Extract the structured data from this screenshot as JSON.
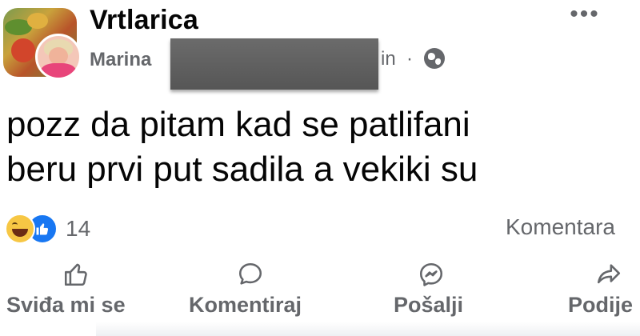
{
  "post": {
    "group_name": "Vrtlarica",
    "author_name": "Marina",
    "time_fragment": "in",
    "separator": "·",
    "visibility_icon": "globe-icon",
    "more_label": "•••",
    "text_lines": [
      "pozz da pitam kad se patlifani",
      "beru prvi put sadila a vekiki su"
    ]
  },
  "stats": {
    "reaction_icons": [
      "haha-icon",
      "like-icon"
    ],
    "reaction_count": "14",
    "comments_label": "Komentara"
  },
  "actions": [
    {
      "icon": "thumbs-up-icon",
      "label": "Sviđa mi se"
    },
    {
      "icon": "comment-icon",
      "label": "Komentiraj"
    },
    {
      "icon": "messenger-icon",
      "label": "Pošalji"
    },
    {
      "icon": "share-icon",
      "label": "Podije"
    }
  ],
  "colors": {
    "text": "#050505",
    "secondary": "#65676b",
    "like_blue": "#1877f2",
    "haha_yellow": "#f7c744"
  }
}
